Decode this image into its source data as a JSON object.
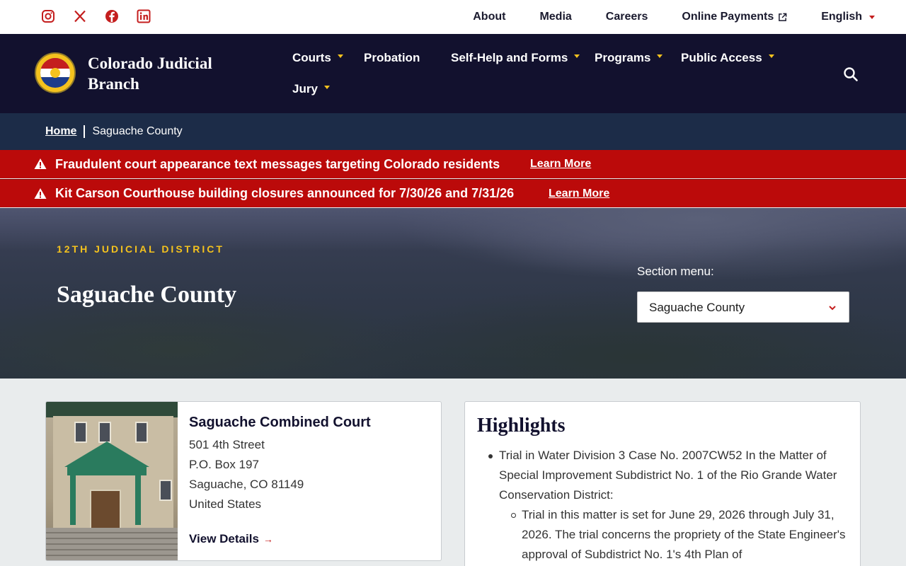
{
  "utility": {
    "social": [
      "instagram-icon",
      "x-icon",
      "facebook-icon",
      "linkedin-icon"
    ],
    "links": [
      "About",
      "Media",
      "Careers",
      "Online Payments",
      "English"
    ]
  },
  "header": {
    "brand": "Colorado Judicial Branch",
    "nav": [
      "Courts",
      "Probation",
      "Self-Help and Forms",
      "Programs",
      "Public Access",
      "Jury"
    ]
  },
  "breadcrumb": {
    "home": "Home",
    "current": "Saguache County"
  },
  "alerts": [
    {
      "message": "Fraudulent court appearance text messages targeting Colorado residents",
      "link": "Learn More"
    },
    {
      "message": "Kit Carson Courthouse building closures announced for 7/30/26 and 7/31/26",
      "link": "Learn More"
    }
  ],
  "hero": {
    "eyebrow": "12TH JUDICIAL DISTRICT",
    "title": "Saguache County",
    "section_label": "Section menu:",
    "section_value": "Saguache County"
  },
  "court": {
    "name": "Saguache Combined Court",
    "address": [
      "501 4th Street",
      "P.O. Box 197",
      "Saguache, CO 81149",
      "United States"
    ],
    "link": "View Details"
  },
  "highlights": {
    "title": "Highlights",
    "item": "Trial in Water Division 3 Case No. 2007CW52 In the Matter of Special Improvement Subdistrict No. 1 of the Rio Grande Water Conservation District:",
    "subitem": "Trial in this matter is set for June 29, 2026 through July 31, 2026. The trial concerns the propriety of the State Engineer's approval of Subdistrict No. 1's 4th Plan of"
  },
  "colors": {
    "navy": "#12112e",
    "alert_red": "#bb0a0a",
    "gold": "#f4c21e",
    "social_red": "#c41e1e"
  }
}
